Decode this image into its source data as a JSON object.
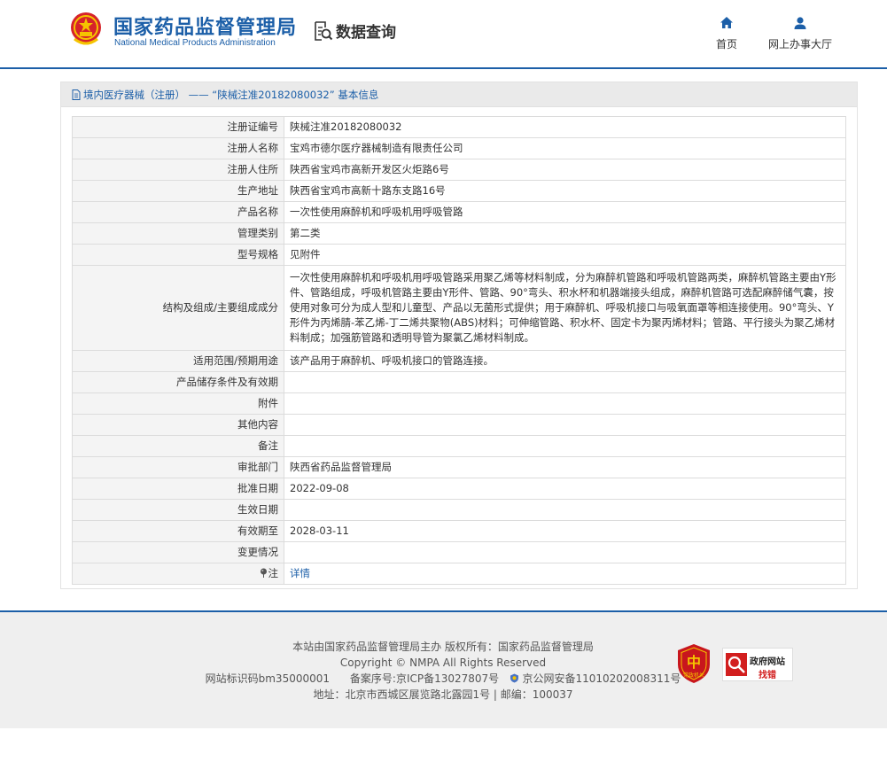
{
  "header": {
    "org_name_cn": "国家药品监督管理局",
    "org_name_en": "National Medical Products Administration",
    "query_label": "数据查询",
    "nav": {
      "home": "首页",
      "online_hall": "网上办事大厅"
    }
  },
  "panel": {
    "title": "境内医疗器械（注册） —— “陕械注准20182080032” 基本信息"
  },
  "rows": [
    {
      "label": "注册证编号",
      "value": "陕械注准20182080032"
    },
    {
      "label": "注册人名称",
      "value": "宝鸡市德尔医疗器械制造有限责任公司"
    },
    {
      "label": "注册人住所",
      "value": "陕西省宝鸡市高新开发区火炬路6号"
    },
    {
      "label": "生产地址",
      "value": "陕西省宝鸡市高新十路东支路16号"
    },
    {
      "label": "产品名称",
      "value": "一次性使用麻醉机和呼吸机用呼吸管路"
    },
    {
      "label": "管理类别",
      "value": "第二类"
    },
    {
      "label": "型号规格",
      "value": "见附件"
    },
    {
      "label": "结构及组成/主要组成成分",
      "value": "一次性使用麻醉机和呼吸机用呼吸管路采用聚乙烯等材料制成，分为麻醉机管路和呼吸机管路两类，麻醉机管路主要由Y形件、管路组成，呼吸机管路主要由Y形件、管路、90°弯头、积水杯和机器端接头组成，麻醉机管路可选配麻醉储气囊，按使用对象可分为成人型和儿童型、产品以无菌形式提供；用于麻醉机、呼吸机接口与吸氧面罩等相连接使用。90°弯头、Y形件为丙烯腈-苯乙烯-丁二烯共聚物(ABS)材料；可伸缩管路、积水杯、固定卡为聚丙烯材料；管路、平行接头为聚乙烯材料制成；加强筋管路和透明导管为聚氯乙烯材料制成。"
    },
    {
      "label": "适用范围/预期用途",
      "value": "该产品用于麻醉机、呼吸机接口的管路连接。"
    },
    {
      "label": "产品储存条件及有效期",
      "value": ""
    },
    {
      "label": "附件",
      "value": ""
    },
    {
      "label": "其他内容",
      "value": ""
    },
    {
      "label": "备注",
      "value": ""
    },
    {
      "label": "审批部门",
      "value": "陕西省药品监督管理局"
    },
    {
      "label": "批准日期",
      "value": "2022-09-08"
    },
    {
      "label": "生效日期",
      "value": ""
    },
    {
      "label": "有效期至",
      "value": "2028-03-11"
    },
    {
      "label": "变更情况",
      "value": ""
    },
    {
      "label": "注",
      "value": "详情"
    }
  ],
  "footer": {
    "line1": "本站由国家药品监督管理局主办 版权所有：国家药品监督管理局",
    "line2": "Copyright © NMPA All Rights Reserved",
    "site_code": "网站标识码bm35000001",
    "icp": "备案序号:京ICP备13027807号",
    "police": "京公网安备11010202008311号",
    "address": "地址：北京市西城区展览路北露园1号 | 邮编：100037",
    "badge1_text": "党政机关",
    "badge2_top": "政府网站",
    "badge2_bottom": "找错"
  },
  "colors": {
    "brand_blue": "#1c5fa8",
    "label_bg": "#f4f4f4",
    "footer_bg": "#efefef"
  }
}
